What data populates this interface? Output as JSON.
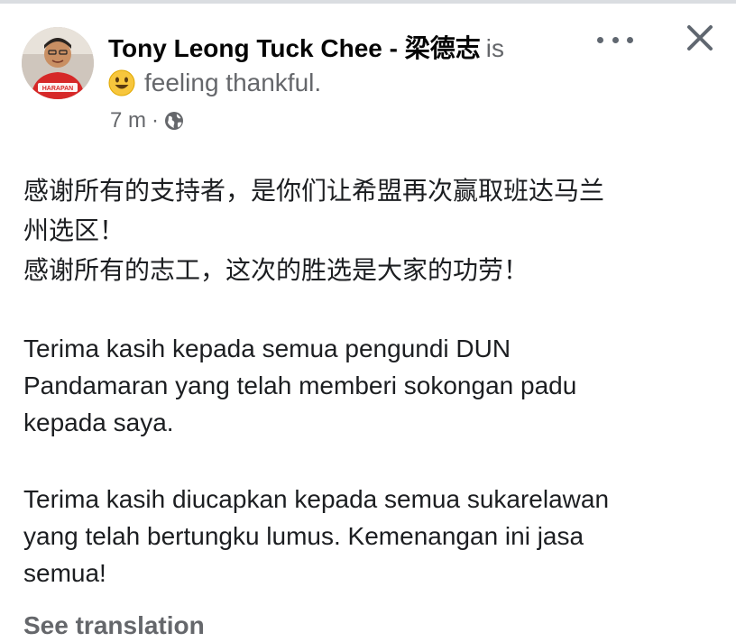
{
  "post": {
    "author": "Tony Leong Tuck Chee - 梁德志",
    "is_text": "is",
    "feeling_text": "feeling thankful.",
    "timestamp": "7 m",
    "separator": "·",
    "avatar_badge": "HARAPAN",
    "body": {
      "zh_line1": "感谢所有的支持者，是你们让希盟再次赢取班达马兰",
      "zh_line2": "州选区！",
      "zh_line3": "感谢所有的志工，这次的胜选是大家的功劳！",
      "ms_para1_line1": "Terima kasih kepada semua pengundi DUN",
      "ms_para1_line2": "Pandamaran yang telah memberi sokongan padu",
      "ms_para1_line3": "kepada saya.",
      "ms_para2_line1": "Terima kasih diucapkan kepada semua sukarelawan",
      "ms_para2_line2": "yang telah bertungku lumus. Kemenangan ini jasa",
      "ms_para2_line3": "semua!"
    },
    "see_translation": "See translation"
  },
  "icons": {
    "feeling_emoji": "smiling-face-icon",
    "privacy": "globe-icon",
    "more": "more-options-icon",
    "close": "close-icon"
  },
  "colors": {
    "text_primary": "#1c1e21",
    "text_secondary": "#65676b",
    "emoji": "#f7c63d"
  }
}
